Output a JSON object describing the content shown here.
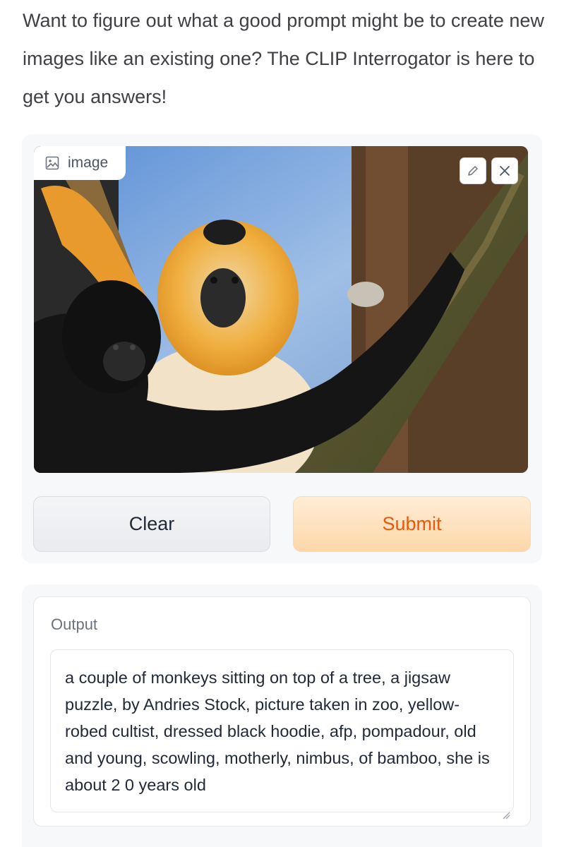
{
  "intro": {
    "text": "Want to figure out what a good prompt might be to create new images like an existing one? The CLIP Interrogator is here to get you answers!"
  },
  "image_input": {
    "label": "image",
    "label_icon": "image-icon",
    "edit_icon": "pencil-icon",
    "close_icon": "close-icon",
    "picture": "photo of two gibbons on a tree branch"
  },
  "buttons": {
    "clear_label": "Clear",
    "submit_label": "Submit"
  },
  "output": {
    "label": "Output",
    "text": "a couple of monkeys sitting on top of a tree, a jigsaw puzzle, by Andries Stock, picture taken in zoo, yellow-robed cultist, dressed black hoodie, afp, pompadour, old and young, scowling, motherly, nimbus, of bamboo, she is about 2 0 years old"
  },
  "colors": {
    "submit_text": "#ea580c",
    "submit_bg": "#fed7aa",
    "panel_bg": "#f7f8fa"
  }
}
